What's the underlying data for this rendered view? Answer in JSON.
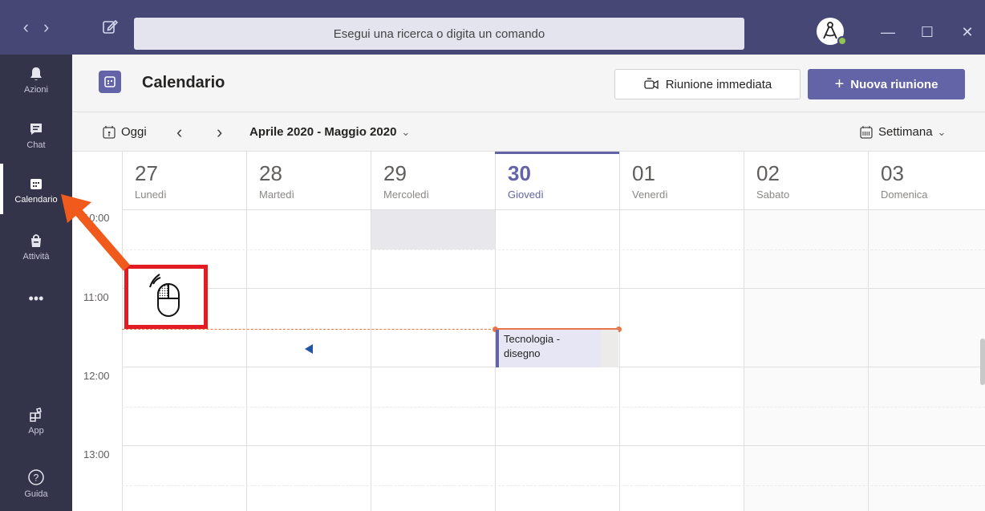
{
  "titlebar": {
    "search_placeholder": "Esegui una ricerca o digita un comando",
    "back_icon": "chevron-left-icon",
    "forward_icon": "chevron-right-icon",
    "minimize": "—",
    "maximize": "☐",
    "close": "✕"
  },
  "rail": {
    "items": [
      {
        "label": "Azioni",
        "icon": "bell-icon"
      },
      {
        "label": "Chat",
        "icon": "chat-icon"
      },
      {
        "label": "Calendario",
        "icon": "calendar-icon"
      },
      {
        "label": "Attività",
        "icon": "bag-icon"
      },
      {
        "label": "•••",
        "icon": "more-icon"
      },
      {
        "label": "App",
        "icon": "apps-icon"
      },
      {
        "label": "Guida",
        "icon": "help-icon"
      }
    ],
    "active": "Calendario"
  },
  "header": {
    "title": "Calendario",
    "meet_now_label": "Riunione immediata",
    "new_meeting_label": "Nuova riunione"
  },
  "toolbar": {
    "today_label": "Oggi",
    "range_label": "Aprile 2020 - Maggio 2020",
    "view_label": "Settimana"
  },
  "days": [
    {
      "num": "27",
      "name": "Lunedì"
    },
    {
      "num": "28",
      "name": "Martedì"
    },
    {
      "num": "29",
      "name": "Mercoledì"
    },
    {
      "num": "30",
      "name": "Giovedì"
    },
    {
      "num": "01",
      "name": "Venerdì"
    },
    {
      "num": "02",
      "name": "Sabato"
    },
    {
      "num": "03",
      "name": "Domenica"
    }
  ],
  "times": [
    "10:00",
    "11:00",
    "12:00",
    "13:00"
  ],
  "event": {
    "line1": "Tecnologia -",
    "line2": "disegno"
  },
  "colors": {
    "accent": "#6264a7",
    "rail": "#33344a",
    "titlebar": "#464775",
    "now_line": "#e97548",
    "annotation": "#e31b23"
  }
}
